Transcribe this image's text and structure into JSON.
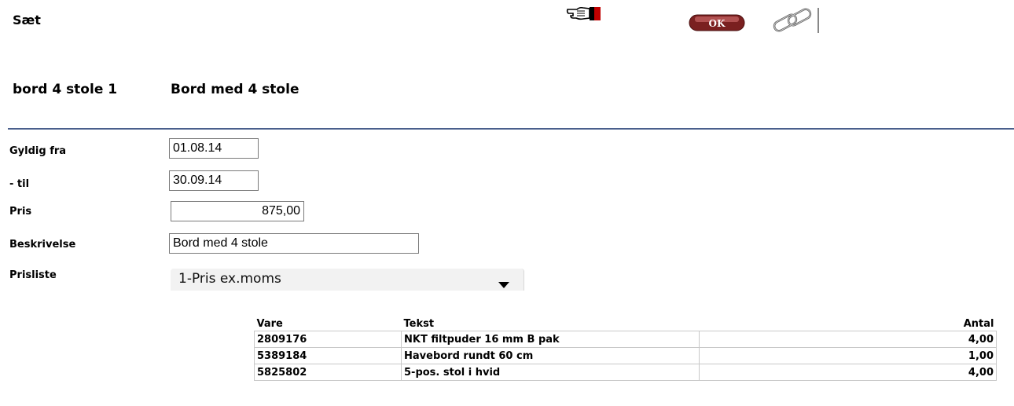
{
  "header": {
    "title": "Sæt"
  },
  "toolbar": {
    "pointer_icon": "pointing-hand-icon",
    "ok_label": "OK",
    "link_icon": "chain-link-icon"
  },
  "set": {
    "code": "bord 4 stole 1",
    "name": "Bord med 4 stole"
  },
  "form": {
    "valid_from_label": "Gyldig fra",
    "valid_from": "01.08.14",
    "valid_to_label": "- til",
    "valid_to": "30.09.14",
    "price_label": "Pris",
    "price": "875,00",
    "description_label": "Beskrivelse",
    "description": "Bord med 4 stole",
    "pricelist_label": "Prisliste",
    "pricelist": "1-Pris ex.moms"
  },
  "lines": {
    "columns": [
      "Vare",
      "Tekst",
      "Antal"
    ],
    "rows": [
      [
        "2809176",
        "NKT filtpuder 16 mm B pak",
        "4,00"
      ],
      [
        "5389184",
        "Havebord rundt 60 cm",
        "1,00"
      ],
      [
        "5825802",
        "5-pos. stol i hvid",
        "4,00"
      ]
    ]
  }
}
